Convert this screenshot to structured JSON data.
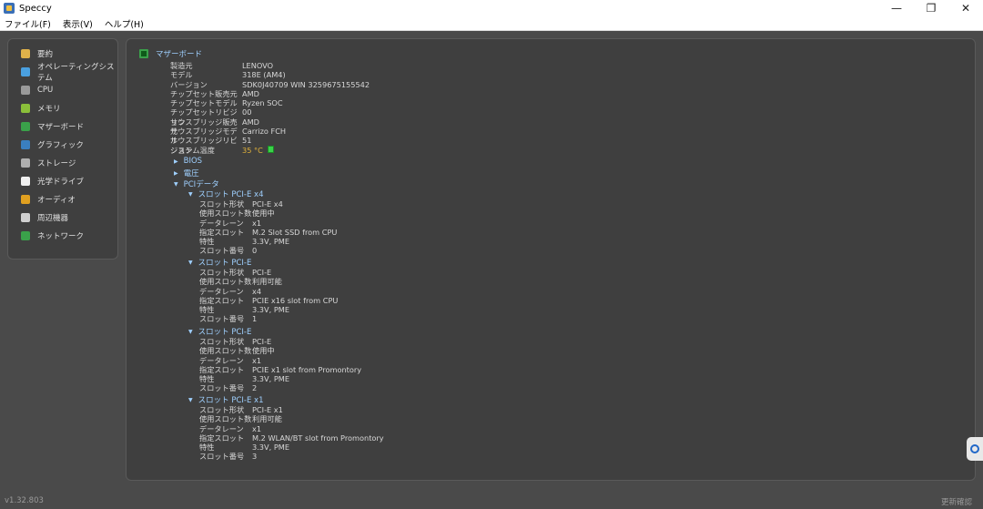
{
  "window": {
    "title": "Speccy",
    "minimize": "—",
    "restore": "❐",
    "close": "✕"
  },
  "menu": [
    "ファイル(F)",
    "表示(V)",
    "ヘルプ(H)"
  ],
  "sidebar": {
    "items": [
      {
        "label": "要約",
        "icon": "summary-icon",
        "color": "#e0b24a"
      },
      {
        "label": "オペレーティングシステム",
        "icon": "windows-icon",
        "color": "#4aa0e0"
      },
      {
        "label": "CPU",
        "icon": "cpu-icon",
        "color": "#9a9a9a"
      },
      {
        "label": "メモリ",
        "icon": "ram-icon",
        "color": "#8bbf3a"
      },
      {
        "label": "マザーボード",
        "icon": "motherboard-icon",
        "color": "#3aa14a"
      },
      {
        "label": "グラフィック",
        "icon": "monitor-icon",
        "color": "#3a7fc0"
      },
      {
        "label": "ストレージ",
        "icon": "hdd-icon",
        "color": "#b0b0b0"
      },
      {
        "label": "光学ドライブ",
        "icon": "disc-icon",
        "color": "#f0f0f0"
      },
      {
        "label": "オーディオ",
        "icon": "speaker-icon",
        "color": "#e0a020"
      },
      {
        "label": "周辺機器",
        "icon": "mouse-icon",
        "color": "#d0d0d0"
      },
      {
        "label": "ネットワーク",
        "icon": "network-icon",
        "color": "#3aa14a"
      }
    ]
  },
  "main": {
    "section_title": "マザーボード",
    "props": [
      {
        "k": "製造元",
        "v": "LENOVO"
      },
      {
        "k": "モデル",
        "v": "318E (AM4)"
      },
      {
        "k": "バージョン",
        "v": "SDK0J40709 WIN 3259675155542"
      },
      {
        "k": "チップセット販売元",
        "v": "AMD"
      },
      {
        "k": "チップセットモデル",
        "v": "Ryzen SOC"
      },
      {
        "k": "チップセットリビジョン",
        "v": "00"
      },
      {
        "k": "サウスブリッジ販売元",
        "v": "AMD"
      },
      {
        "k": "サウスブリッジモデル",
        "v": "Carrizo FCH"
      },
      {
        "k": "サウスブリッジリビジョン",
        "v": "51"
      }
    ],
    "temp": {
      "k": "システム温度",
      "v": "35 °C"
    },
    "tree": {
      "bios": "BIOS",
      "voltage": "電圧",
      "pci": "PCIデータ"
    },
    "slots": [
      {
        "title": "スロット PCI-E x4",
        "rows": [
          {
            "k": "スロット形状",
            "v": "PCI-E x4"
          },
          {
            "k": "使用スロット数",
            "v": "使用中"
          },
          {
            "k": "データレーン",
            "v": "x1"
          },
          {
            "k": "指定スロット",
            "v": "M.2 Slot SSD from CPU"
          },
          {
            "k": "特性",
            "v": "3.3V, PME"
          },
          {
            "k": "スロット番号",
            "v": "0"
          }
        ]
      },
      {
        "title": "スロット PCI-E",
        "rows": [
          {
            "k": "スロット形状",
            "v": "PCI-E"
          },
          {
            "k": "使用スロット数",
            "v": "利用可能"
          },
          {
            "k": "データレーン",
            "v": "x4"
          },
          {
            "k": "指定スロット",
            "v": "PCIE x16 slot from CPU"
          },
          {
            "k": "特性",
            "v": "3.3V, PME"
          },
          {
            "k": "スロット番号",
            "v": "1"
          }
        ]
      },
      {
        "title": "スロット PCI-E",
        "rows": [
          {
            "k": "スロット形状",
            "v": "PCI-E"
          },
          {
            "k": "使用スロット数",
            "v": "使用中"
          },
          {
            "k": "データレーン",
            "v": "x1"
          },
          {
            "k": "指定スロット",
            "v": "PCIE x1 slot from Promontory"
          },
          {
            "k": "特性",
            "v": "3.3V, PME"
          },
          {
            "k": "スロット番号",
            "v": "2"
          }
        ]
      },
      {
        "title": "スロット PCI-E x1",
        "rows": [
          {
            "k": "スロット形状",
            "v": "PCI-E x1"
          },
          {
            "k": "使用スロット数",
            "v": "利用可能"
          },
          {
            "k": "データレーン",
            "v": "x1"
          },
          {
            "k": "指定スロット",
            "v": "M.2 WLAN/BT slot from Promontory"
          },
          {
            "k": "特性",
            "v": "3.3V, PME"
          },
          {
            "k": "スロット番号",
            "v": "3"
          }
        ]
      }
    ]
  },
  "footer": {
    "version": "v1.32.803",
    "update": "更新確認"
  }
}
